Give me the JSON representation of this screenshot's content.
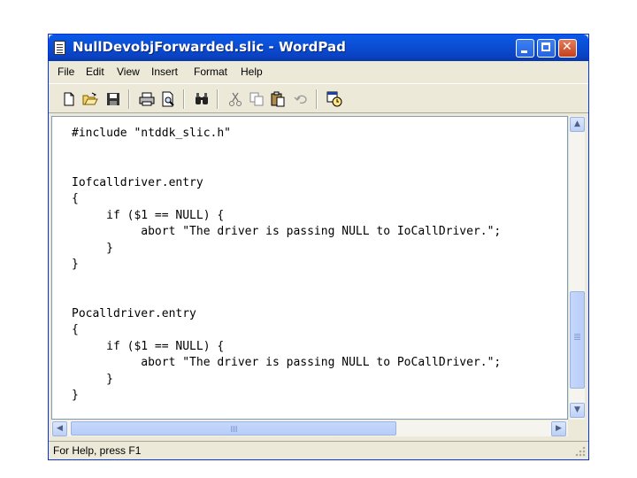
{
  "window": {
    "title": "NullDevobjForwarded.slic - WordPad"
  },
  "menu": [
    "File",
    "Edit",
    "View",
    "Insert",
    "Format",
    "Help"
  ],
  "toolbar": {
    "icons": [
      "new-document-icon",
      "open-folder-icon",
      "save-icon",
      "print-icon",
      "print-preview-icon",
      "find-icon",
      "cut-icon",
      "copy-icon",
      "paste-icon",
      "undo-icon",
      "insert-date-time-icon"
    ]
  },
  "document": {
    "lines": [
      "#include \"ntddk_slic.h\"",
      "",
      "",
      "Iofcalldriver.entry",
      "{",
      "     if ($1 == NULL) {",
      "          abort \"The driver is passing NULL to IoCallDriver.\";",
      "     }",
      "}",
      "",
      "",
      "Pocalldriver.entry",
      "{",
      "     if ($1 == NULL) {",
      "          abort \"The driver is passing NULL to PoCallDriver.\";",
      "     }",
      "}"
    ]
  },
  "statusbar": {
    "text": "For Help, press F1"
  },
  "colors": {
    "titlebar": "#0a5ae6",
    "chrome": "#ece9d8",
    "close_button": "#c4401c"
  }
}
